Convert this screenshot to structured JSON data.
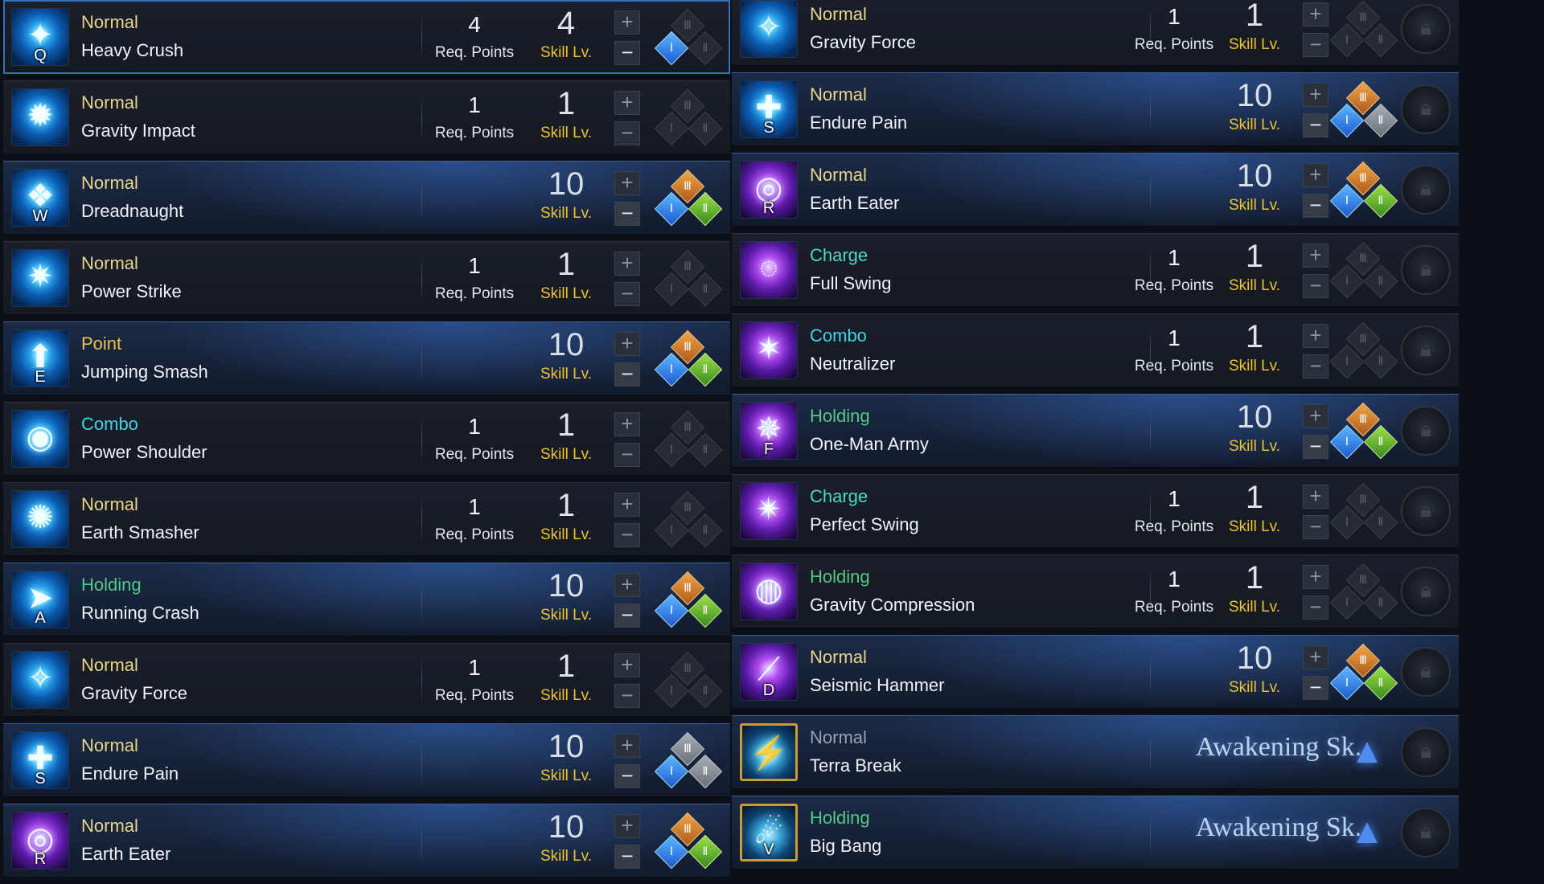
{
  "labels": {
    "req_points": "Req. Points",
    "skill_lv": "Skill Lv.",
    "awakening": "Awakening Sk.",
    "plus": "+",
    "minus": "−"
  },
  "colors": {
    "type_normal": "#e8d68a",
    "type_point": "#e8c24a",
    "type_combo": "#3fd3e6",
    "type_holding": "#54c884",
    "type_charge": "#4fd8c4",
    "skill_lv_label": "#f0c22c"
  },
  "left_skills": [
    {
      "type": "Normal",
      "name": "Heavy Crush",
      "key": "Q",
      "req": "4",
      "level": "4",
      "icon": "hammer-icon"
    },
    {
      "type": "Normal",
      "name": "Gravity Impact",
      "key": "",
      "req": "1",
      "level": "1",
      "icon": "impact-icon"
    },
    {
      "type": "Normal",
      "name": "Dreadnaught",
      "key": "W",
      "req": "",
      "level": "10",
      "icon": "dreadnaught-icon"
    },
    {
      "type": "Normal",
      "name": "Power Strike",
      "key": "",
      "req": "1",
      "level": "1",
      "icon": "strike-icon"
    },
    {
      "type": "Point",
      "name": "Jumping Smash",
      "key": "E",
      "req": "",
      "level": "10",
      "icon": "jump-icon"
    },
    {
      "type": "Combo",
      "name": "Power Shoulder",
      "key": "",
      "req": "1",
      "level": "1",
      "icon": "shoulder-icon"
    },
    {
      "type": "Normal",
      "name": "Earth Smasher",
      "key": "",
      "req": "1",
      "level": "1",
      "icon": "smasher-icon"
    },
    {
      "type": "Holding",
      "name": "Running Crash",
      "key": "A",
      "req": "",
      "level": "10",
      "icon": "crash-icon"
    },
    {
      "type": "Normal",
      "name": "Gravity Force",
      "key": "",
      "req": "1",
      "level": "1",
      "icon": "force-icon"
    },
    {
      "type": "Normal",
      "name": "Endure Pain",
      "key": "S",
      "req": "",
      "level": "10",
      "icon": "endure-icon"
    },
    {
      "type": "Normal",
      "name": "Earth Eater",
      "key": "R",
      "req": "",
      "level": "10",
      "icon": "eater-icon"
    }
  ],
  "right_skills": [
    {
      "type": "Normal",
      "name": "Gravity Force",
      "key": "",
      "req": "1",
      "level": "1",
      "icon": "force-icon"
    },
    {
      "type": "Normal",
      "name": "Endure Pain",
      "key": "S",
      "req": "",
      "level": "10",
      "icon": "endure-icon"
    },
    {
      "type": "Normal",
      "name": "Earth Eater",
      "key": "R",
      "req": "",
      "level": "10",
      "icon": "eater-icon"
    },
    {
      "type": "Charge",
      "name": "Full Swing",
      "key": "",
      "req": "1",
      "level": "1",
      "icon": "swing-icon"
    },
    {
      "type": "Combo",
      "name": "Neutralizer",
      "key": "",
      "req": "1",
      "level": "1",
      "icon": "neutralizer-icon"
    },
    {
      "type": "Holding",
      "name": "One-Man Army",
      "key": "F",
      "req": "",
      "level": "10",
      "icon": "army-icon"
    },
    {
      "type": "Charge",
      "name": "Perfect Swing",
      "key": "",
      "req": "1",
      "level": "1",
      "icon": "perfect-swing-icon"
    },
    {
      "type": "Holding",
      "name": "Gravity Compression",
      "key": "",
      "req": "1",
      "level": "1",
      "icon": "compression-icon"
    },
    {
      "type": "Normal",
      "name": "Seismic Hammer",
      "key": "D",
      "req": "",
      "level": "10",
      "icon": "seismic-icon"
    },
    {
      "type": "Normal",
      "name": "Terra Break",
      "key": "",
      "req": "",
      "level": "",
      "icon": "terra-break-icon",
      "awakening": true
    },
    {
      "type": "Holding",
      "name": "Big Bang",
      "key": "V",
      "req": "",
      "level": "",
      "icon": "big-bang-icon",
      "awakening": true
    }
  ]
}
